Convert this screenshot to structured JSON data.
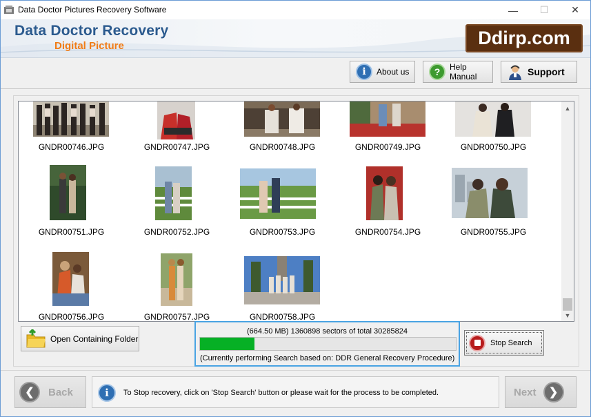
{
  "window": {
    "title": "Data Doctor Pictures Recovery Software",
    "controls": {
      "minimize": "—",
      "maximize": "☐",
      "close": "✕"
    }
  },
  "banner": {
    "title": "Data Doctor Recovery",
    "subtitle": "Digital Picture",
    "logo": "Ddirp.com"
  },
  "header_buttons": {
    "about": "About us",
    "help": "Help Manual",
    "support": "Support"
  },
  "gallery": {
    "files": [
      "GNDR00746.JPG",
      "GNDR00747.JPG",
      "GNDR00748.JPG",
      "GNDR00749.JPG",
      "GNDR00750.JPG",
      "GNDR00751.JPG",
      "GNDR00752.JPG",
      "GNDR00753.JPG",
      "GNDR00754.JPG",
      "GNDR00755.JPG",
      "GNDR00756.JPG",
      "GNDR00757.JPG",
      "GNDR00758.JPG"
    ],
    "scroll_up": "▲",
    "scroll_down": "▼"
  },
  "actions": {
    "open_folder": "Open Containing Folder",
    "stop_search": "Stop Search"
  },
  "progress": {
    "stats": "(664.50 MB) 1360898  sectors  of  total 30285824",
    "fraction": 0.212,
    "status": "(Currently performing Search based on:  DDR General Recovery Procedure)"
  },
  "footer": {
    "back": "Back",
    "next": "Next",
    "message": "To Stop recovery, click on 'Stop Search' button or please wait for the process to be completed."
  },
  "colors": {
    "title_blue": "#2b5a8e",
    "subtitle_orange": "#f07c16",
    "progress_green": "#06b025",
    "focus_border": "#49a3e3"
  }
}
